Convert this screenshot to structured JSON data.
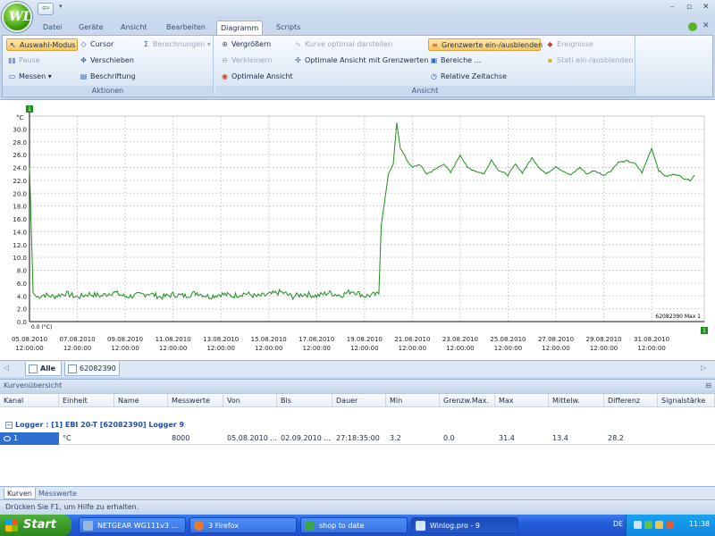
{
  "quick_access": {
    "back_label": "⇦",
    "dropdown": "▾"
  },
  "window_controls": {
    "minimize": "–",
    "restore": "▫",
    "close": "✕"
  },
  "tabs": [
    "Datei",
    "Geräte",
    "Ansicht",
    "Bearbeiten",
    "Diagramm",
    "Scripts"
  ],
  "active_tab": "Diagramm",
  "ribbon": {
    "aktionen": {
      "label": "Aktionen",
      "auswahl": "Auswahl-Modus",
      "pause": "Pause",
      "messen": "Messen",
      "cursor": "Cursor",
      "verschieben": "Verschieben",
      "beschriftung": "Beschriftung",
      "berechnungen": "Berechnungen"
    },
    "ansicht": {
      "label": "Ansicht",
      "vergroessern": "Vergrößern",
      "verkleinern": "Verkleinern",
      "optimale_ansicht": "Optimale Ansicht",
      "kurve_optimal": "Kurve optimal darstellen",
      "optimale_grenzwerte": "Optimale Ansicht mit Grenzwerten",
      "grenzwerte": "Grenzwerte ein-/ausblenden",
      "bereiche": "Bereiche ...",
      "relative_zeitachse": "Relative Zeitachse",
      "ereignisse": "Ereignisse",
      "stati": "Stati ein-/ausblenden"
    }
  },
  "chart_data": {
    "type": "line",
    "ylabel": "°C",
    "ylim": [
      0,
      32
    ],
    "yticks": [
      0.0,
      2.0,
      4.0,
      6.0,
      8.0,
      10.0,
      12.0,
      14.0,
      16.0,
      18.0,
      20.0,
      22.0,
      23.0,
      24.0,
      26.0,
      28.0,
      30.0
    ],
    "ytick_labels": [
      "0.0",
      "2.0",
      "4.0",
      "6.0",
      "8.0",
      "10.0",
      "12.0",
      "14.0",
      "16.0",
      "18.0",
      "20.0",
      "22.0",
      "24.0",
      "26.0",
      "28.0",
      "30.0"
    ],
    "x_ticks": [
      {
        "date": "05.08.2010",
        "time": "12:00:00"
      },
      {
        "date": "07.08.2010",
        "time": "12:00:00"
      },
      {
        "date": "09.08.2010",
        "time": "12:00:00"
      },
      {
        "date": "11.08.2010",
        "time": "12:00:00"
      },
      {
        "date": "13.08.2010",
        "time": "12:00:00"
      },
      {
        "date": "15.08.2010",
        "time": "12:00:00"
      },
      {
        "date": "17.08.2010",
        "time": "12:00:00"
      },
      {
        "date": "19.08.2010",
        "time": "12:00:00"
      },
      {
        "date": "21.08.2010",
        "time": "12:00:00"
      },
      {
        "date": "23.08.2010",
        "time": "12:00:00"
      },
      {
        "date": "25.08.2010",
        "time": "12:00:00"
      },
      {
        "date": "27.08.2010",
        "time": "12:00:00"
      },
      {
        "date": "29.08.2010",
        "time": "12:00:00"
      },
      {
        "date": "31.08.2010",
        "time": "12:00:00"
      }
    ],
    "xlim_days": [
      0,
      28.2
    ],
    "series": [
      {
        "name": "62082390",
        "color": "#1f8f1f",
        "x_days": [
          0.0,
          0.05,
          0.15,
          0.3,
          0.6,
          1.0,
          1.5,
          2.0,
          2.5,
          3.0,
          3.5,
          4.0,
          4.5,
          5.0,
          5.5,
          6.0,
          6.5,
          7.0,
          7.5,
          8.0,
          8.5,
          9.0,
          9.5,
          10.0,
          10.5,
          11.0,
          11.5,
          12.0,
          12.5,
          13.0,
          13.5,
          14.0,
          14.5,
          14.6,
          14.7,
          15.0,
          15.2,
          15.35,
          15.5,
          15.8,
          16.0,
          16.3,
          16.6,
          17.0,
          17.3,
          17.6,
          18.0,
          18.3,
          18.6,
          19.0,
          19.3,
          19.6,
          20.0,
          20.3,
          20.6,
          21.0,
          21.3,
          21.6,
          22.0,
          22.3,
          22.6,
          23.0,
          23.3,
          23.6,
          24.0,
          24.3,
          24.6,
          25.0,
          25.3,
          25.6,
          26.0,
          26.3,
          26.6,
          27.0,
          27.3,
          27.6,
          27.8
        ],
        "values": [
          24.0,
          18.0,
          4.5,
          3.8,
          4.2,
          3.9,
          4.4,
          3.8,
          4.3,
          4.0,
          4.6,
          3.9,
          4.1,
          4.4,
          3.8,
          4.2,
          4.0,
          4.5,
          3.9,
          4.3,
          4.0,
          4.4,
          3.9,
          4.2,
          4.6,
          3.9,
          4.3,
          4.0,
          4.5,
          4.1,
          4.8,
          4.0,
          4.2,
          4.3,
          15.0,
          23.0,
          24.5,
          31.0,
          27.0,
          25.0,
          24.0,
          24.5,
          23.0,
          23.8,
          24.6,
          23.2,
          26.0,
          24.0,
          23.5,
          23.0,
          25.2,
          23.6,
          22.8,
          24.5,
          23.2,
          25.5,
          24.0,
          23.0,
          24.2,
          23.4,
          22.8,
          24.0,
          23.0,
          23.5,
          22.8,
          23.5,
          24.8,
          25.0,
          24.6,
          23.2,
          27.0,
          23.5,
          22.6,
          23.0,
          22.4,
          22.0,
          22.8
        ],
        "after": [
          24.5,
          23.0,
          22.0
        ]
      }
    ],
    "top_marker": "1",
    "right_marker": "1",
    "legend_text": "62082390 Max 1",
    "corner_label": "0.0 (°C)"
  },
  "doc_tabs": [
    "Alle",
    "62082390"
  ],
  "panel": {
    "title": "Kurvenübersicht",
    "pin": "⊟",
    "columns": [
      "Kanal",
      "Einheit",
      "Name",
      "Messwerte",
      "Von",
      "Bis",
      "Dauer",
      "Min",
      "Grenzw.Max.",
      "Max",
      "Mittelw.",
      "Differenz",
      "Signalstärke"
    ],
    "group": "Logger : [1] EBI 20-T [62082390] Logger 9",
    "row": {
      "kanal": "1",
      "einheit": "°C",
      "name": "",
      "messwerte": "8000",
      "von": "05.08.2010 ...",
      "bis": "02.09.2010 ...",
      "dauer": "27:18:35:00",
      "min": "3.2",
      "grenzw_max": "0.0",
      "max": "31.4",
      "mittelw": "13.4",
      "differenz": "28.2",
      "signalstaerke": ""
    },
    "bottom_tabs": [
      "Kurven",
      "Messwerte"
    ]
  },
  "status": "Drücken Sie F1, um Hilfe zu erhalten.",
  "taskbar": {
    "start": "Start",
    "items": [
      "NETGEAR WG111v3 ...",
      "3 Firefox",
      "shop to date",
      "Winlog.pro - 9"
    ],
    "lang": "DE",
    "clock": "11:38"
  },
  "app_logo": "WL"
}
